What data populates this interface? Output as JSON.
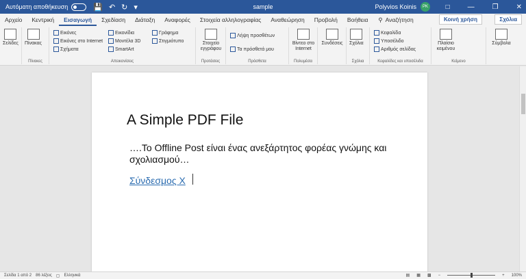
{
  "titlebar": {
    "autosave_label": "Αυτόματη αποθήκευση",
    "doc_title": "sample",
    "user_name": "Polyvios Koinis",
    "avatar_initials": "PK"
  },
  "tabs": [
    "Αρχείο",
    "Κεντρική",
    "Εισαγωγή",
    "Σχεδίαση",
    "Διάταξη",
    "Αναφορές",
    "Στοιχεία αλληλογραφίας",
    "Αναθεώρηση",
    "Προβολή",
    "Βοήθεια"
  ],
  "search_label": "Αναζήτηση",
  "share_label": "Κοινή χρήση",
  "comments_label": "Σχόλια",
  "ribbon": {
    "pages": "Σελίδες",
    "table": "Πίνακας",
    "tables_group": "Πίνακες",
    "pictures": "Εικόνες",
    "online_pictures": "Εικόνες στο Internet",
    "shapes": "Σχήματα",
    "icons": "Εικονίδια",
    "models3d": "Μοντέλα 3D",
    "smartart": "SmartArt",
    "chart": "Γράφημα",
    "screenshot": "Στιγμιότυπο",
    "illustrations_group": "Απεικονίσεις",
    "doc_item": "Στοιχείο εγγράφου",
    "proposals_group": "Προτάσεις",
    "get_addins": "Λήψη προσθέτων",
    "my_addins": "Τα πρόσθετά μου",
    "addins_group": "Πρόσθετα",
    "online_video": "Βίντεο στο Internet",
    "media_group": "Πολυμέσα",
    "links": "Συνδέσεις",
    "comment": "Σχόλια",
    "comments_group": "Σχόλια",
    "header": "Κεφαλίδα",
    "footer": "Υποσέλιδο",
    "page_number": "Αριθμός σελίδας",
    "header_footer_group": "Κεφαλίδες και υποσέλιδα",
    "textbox": "Πλαίσιο κειμένου",
    "text_group": "Κείμενο",
    "symbols": "Σύμβολα"
  },
  "document": {
    "heading": "A Simple PDF File",
    "paragraph": "….Το Offline Post είναι ένας ανεξάρτητος φορέας γνώμης και σχολιασμού…",
    "link_text": "Σύνδεσμος Χ"
  },
  "status": {
    "page": "Σελίδα 1 από 2",
    "words": "86 λέξεις",
    "language": "Ελληνικά",
    "zoom": "100%"
  }
}
